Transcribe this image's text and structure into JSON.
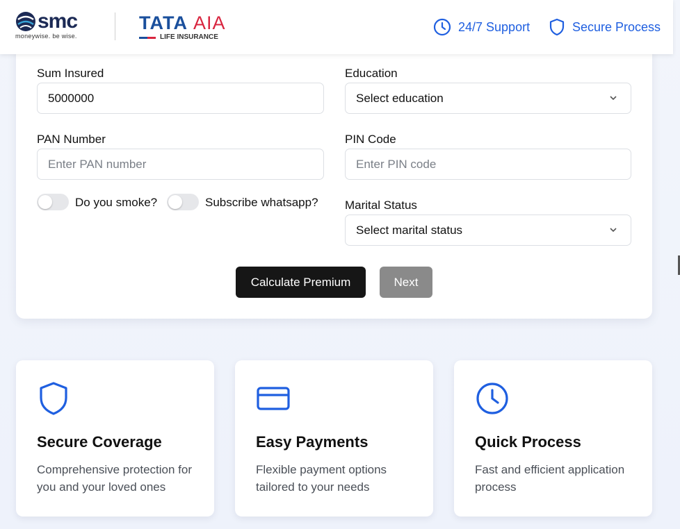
{
  "header": {
    "smc_logo_text": "smc",
    "smc_tagline": "moneywise. be wise.",
    "tata_logo_text": "TATA",
    "aia_logo_text": "AIA",
    "tata_sub": "LIFE INSURANCE",
    "support_label": "24/7 Support",
    "secure_label": "Secure Process"
  },
  "form": {
    "sum_insured_label": "Sum Insured",
    "sum_insured_value": "5000000",
    "education_label": "Education",
    "education_value": "Select education",
    "pan_label": "PAN Number",
    "pan_placeholder": "Enter PAN number",
    "pin_label": "PIN Code",
    "pin_placeholder": "Enter PIN code",
    "smoke_label": "Do you smoke?",
    "whatsapp_label": "Subscribe whatsapp?",
    "marital_label": "Marital Status",
    "marital_value": "Select marital status",
    "calculate_label": "Calculate Premium",
    "next_label": "Next"
  },
  "features": [
    {
      "title": "Secure Coverage",
      "desc": "Comprehensive protection for you and your loved ones",
      "icon": "shield-icon"
    },
    {
      "title": "Easy Payments",
      "desc": "Flexible payment options tailored to your needs",
      "icon": "credit-card-icon"
    },
    {
      "title": "Quick Process",
      "desc": "Fast and efficient application process",
      "icon": "clock-icon"
    }
  ],
  "colors": {
    "accent": "#1f5fe0",
    "primary_button": "#161616",
    "disabled_button": "#8a8a8a"
  }
}
